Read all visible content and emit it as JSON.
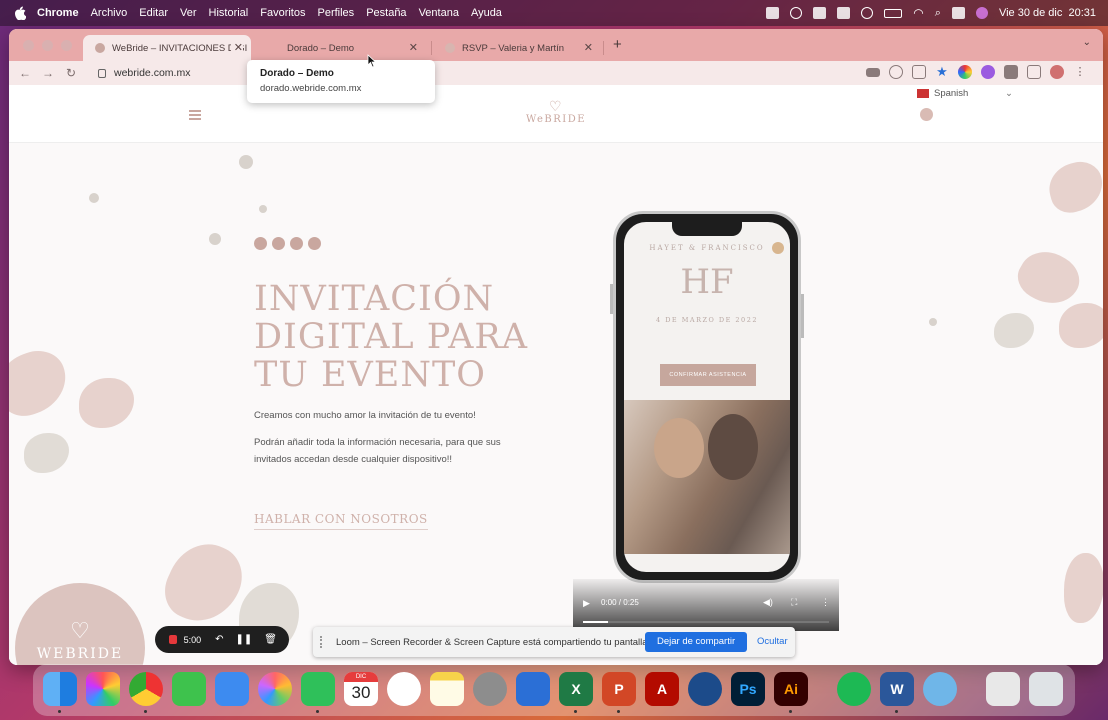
{
  "menubar": {
    "app_name": "Chrome",
    "menus": [
      "Archivo",
      "Editar",
      "Ver",
      "Historial",
      "Favoritos",
      "Perfiles",
      "Pestaña",
      "Ventana",
      "Ayuda"
    ],
    "clock": "Vie 30 de dic  20:31"
  },
  "browser": {
    "tabs": [
      {
        "title": "WeBride – INVITACIONES DIGI",
        "active": true
      },
      {
        "title": "Dorado – Demo",
        "active": false
      },
      {
        "title": "RSVP – Valeria y Martín",
        "active": false
      }
    ],
    "new_tab": "+",
    "url": "webride.com.mx",
    "tooltip": {
      "title": "Dorado – Demo",
      "url": "dorado.webride.com.mx"
    }
  },
  "site": {
    "logo_text": "WeBRIDE",
    "language": "Spanish",
    "hero": {
      "title": "INVITACIÓN DIGITAL PARA TU EVENTO",
      "paragraph1": "Creamos con mucho amor la invitación de tu evento!",
      "paragraph2": "Podrán añadir toda la información necesaria, para que sus invitados accedan desde cualquier dispositivo!!",
      "cta": "HABLAR CON NOSOTROS"
    },
    "phone": {
      "names": "HAYET & FRANCISCO",
      "monogram": "HF",
      "date": "4 DE MARZO DE 2022",
      "button": "CONFIRMAR ASISTENCIA"
    },
    "video": {
      "time": "0:00 / 0:25",
      "progress": 0.1
    },
    "badge_text": "WEBRIDE"
  },
  "loom": {
    "timer": "5:00",
    "share_message": "Loom – Screen Recorder & Screen Capture está compartiendo tu pantalla.",
    "stop_label": "Dejar de compartir",
    "hide_label": "Ocultar"
  },
  "dock": {
    "calendar_month": "DIC",
    "calendar_day": "30",
    "apps": [
      "finder",
      "launchpad",
      "chrome",
      "messages",
      "mail",
      "photos",
      "whatsapp",
      "calendar",
      "airdrop",
      "notes",
      "system-settings",
      "screen-capture",
      "excel",
      "powerpoint",
      "acrobat",
      "vpn",
      "photoshop",
      "illustrator",
      "spotify",
      "word",
      "finder-2",
      "documents",
      "trash"
    ]
  }
}
